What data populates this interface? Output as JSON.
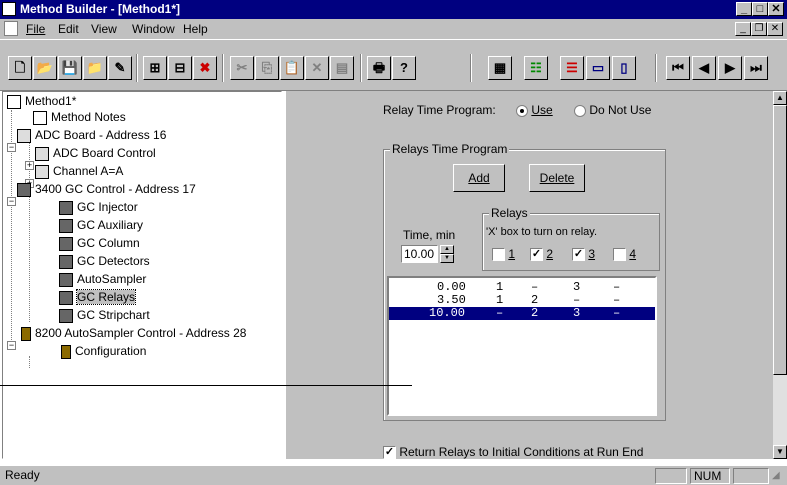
{
  "window": {
    "title": "Method Builder - [Method1*]"
  },
  "menu": {
    "items": [
      "File",
      "Edit",
      "View",
      "Window",
      "Help"
    ]
  },
  "tree": {
    "root": "Method1*",
    "method_notes": "Method Notes",
    "adc_board": "ADC Board - Address 16",
    "adc_board_control": "ADC Board Control",
    "channel": "Channel A=A",
    "gc_control": "3400 GC Control - Address 17",
    "gc_injector": "GC Injector",
    "gc_auxiliary": "GC Auxiliary",
    "gc_column": "GC Column",
    "gc_detectors": "GC Detectors",
    "autosampler": "AutoSampler",
    "gc_relays": "GC Relays",
    "gc_stripchart": "GC Stripchart",
    "as_control": "8200 AutoSampler Control - Address 28",
    "configuration": "Configuration"
  },
  "relay": {
    "time_program_label": "Relay Time Program:",
    "use_label": "Use",
    "do_not_use_label": "Do Not Use",
    "use_selected": true,
    "group_title": "Relays Time Program",
    "add_label": "Add",
    "delete_label": "Delete",
    "time_label": "Time, min",
    "time_value": "10.00",
    "relays_group_title": "Relays",
    "relays_hint": "'X' box to turn on relay.",
    "relays": [
      {
        "label": "1",
        "checked": false
      },
      {
        "label": "2",
        "checked": true
      },
      {
        "label": "3",
        "checked": true
      },
      {
        "label": "4",
        "checked": false
      }
    ],
    "rows": [
      {
        "time": "0.00",
        "r1": "1",
        "r2": "–",
        "r3": "3",
        "r4": "–"
      },
      {
        "time": "3.50",
        "r1": "1",
        "r2": "2",
        "r3": "–",
        "r4": "–"
      },
      {
        "time": "10.00",
        "r1": "–",
        "r2": "2",
        "r3": "3",
        "r4": "–"
      }
    ],
    "selected_row": 2,
    "return_label": "Return Relays to Initial Conditions at Run End",
    "return_checked": true
  },
  "status": {
    "text": "Ready",
    "num": "NUM"
  }
}
